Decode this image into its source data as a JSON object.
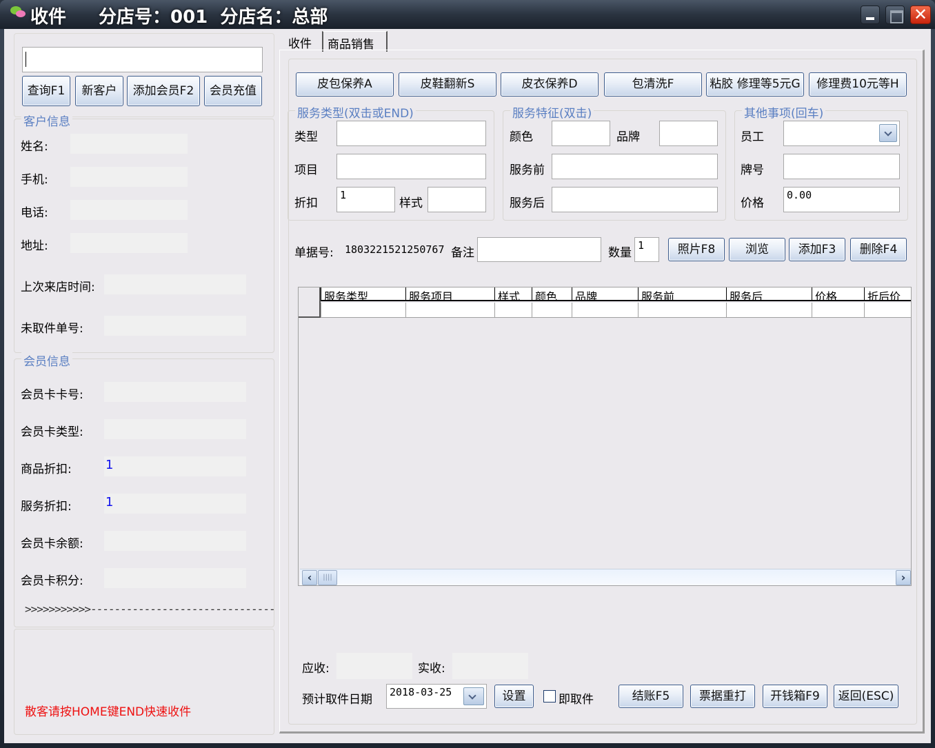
{
  "window": {
    "title": "收件",
    "store_info": "分店号：001  分店名：总部",
    "controls": {
      "minimize": "minimize",
      "maximize": "maximize",
      "close": "✕"
    }
  },
  "left": {
    "search": {
      "value": "",
      "placeholder": ""
    },
    "buttons": [
      "查询F1",
      "新客户",
      "添加会员F2",
      "会员充值"
    ],
    "customer_info": {
      "title": "客户信息",
      "fields": [
        {
          "label": "姓名:",
          "value": ""
        },
        {
          "label": "手机:",
          "value": ""
        },
        {
          "label": "电话:",
          "value": ""
        },
        {
          "label": "地址:",
          "value": ""
        },
        {
          "label": "上次来店时间:",
          "value": ""
        },
        {
          "label": "未取件单号:",
          "value": ""
        }
      ]
    },
    "member_info": {
      "title": "会员信息",
      "fields": [
        {
          "label": "会员卡卡号:",
          "value": ""
        },
        {
          "label": "会员卡类型:",
          "value": ""
        },
        {
          "label": "商品折扣:",
          "value": "1"
        },
        {
          "label": "服务折扣:",
          "value": "1"
        },
        {
          "label": "会员卡余额:",
          "value": ""
        },
        {
          "label": "会员卡积分:",
          "value": ""
        }
      ],
      "progress_text": ">>>>>>>>>>>-------------------------------"
    },
    "hint": "散客请按HOME键END快速收件",
    "hint_color": "#ee1111"
  },
  "tabs": [
    {
      "label": "收件",
      "active": true
    },
    {
      "label": "商品销售",
      "active": false
    }
  ],
  "quick_buttons": [
    "皮包保养A",
    "皮鞋翻新S",
    "皮衣保养D",
    "包清洗F",
    "粘胶 修理等5元G",
    "修理费10元等H"
  ],
  "service_type": {
    "title": "服务类型(双击或END)",
    "type_label": "类型",
    "type_value": "",
    "item_label": "项目",
    "item_value": "",
    "discount_label": "折扣",
    "discount_value": "1",
    "style_label": "样式",
    "style_value": ""
  },
  "service_features": {
    "title": "服务特征(双击)",
    "color_label": "颜色",
    "color_value": "",
    "brand_label": "品牌",
    "brand_value": "",
    "before_label": "服务前",
    "before_value": "",
    "after_label": "服务后",
    "after_value": ""
  },
  "other": {
    "title": "其他事项(回车)",
    "staff_label": "员工",
    "staff_value": "",
    "tag_label": "牌号",
    "tag_value": "",
    "price_label": "价格",
    "price_value": "0.00"
  },
  "order": {
    "number_label": "单据号:",
    "number": "1803221521250767",
    "remark_label": "备注",
    "remark_value": "",
    "qty_label": "数量",
    "qty_value": "1",
    "buttons": [
      "照片F8",
      "浏览",
      "添加F3",
      "删除F4"
    ]
  },
  "grid": {
    "columns": [
      "服务类型",
      "服务项目",
      "样式",
      "颜色",
      "品牌",
      "服务前",
      "服务后",
      "价格",
      "折后价"
    ],
    "rows": [
      [
        "",
        "",
        "",
        "",
        "",
        "",
        "",
        "",
        ""
      ]
    ]
  },
  "totals": {
    "receivable_label": "应收:",
    "receivable_value": "",
    "received_label": "实收:",
    "received_value": ""
  },
  "pickup": {
    "date_label": "预计取件日期",
    "date_value": "2018-03-25",
    "set_button": "设置",
    "instant_label": "即取件",
    "instant_checked": false
  },
  "action_buttons": [
    "结账F5",
    "票据重打",
    "开钱箱F9",
    "返回(ESC)"
  ]
}
